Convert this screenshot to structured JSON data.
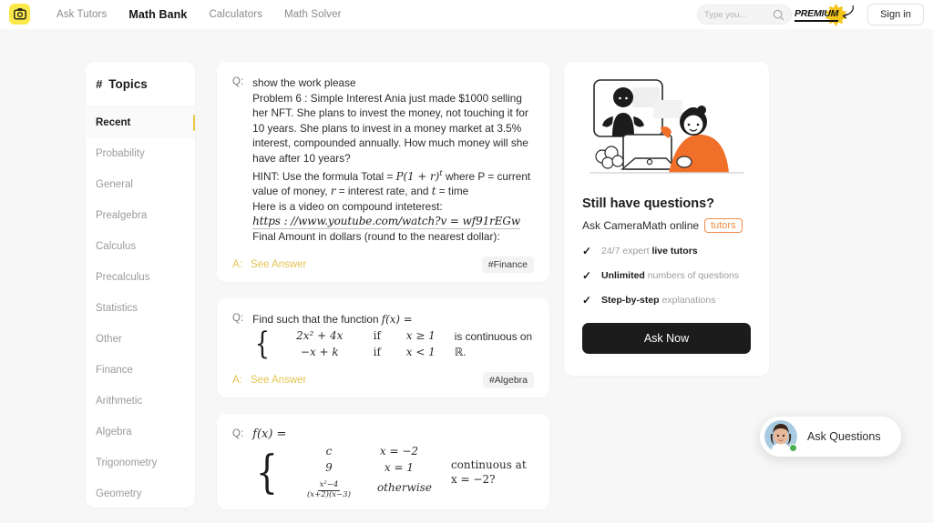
{
  "header": {
    "logo_icon": "camera-icon",
    "nav": [
      {
        "label": "Ask Tutors",
        "active": false
      },
      {
        "label": "Math Bank",
        "active": true
      },
      {
        "label": "Calculators",
        "active": false
      },
      {
        "label": "Math Solver",
        "active": false
      }
    ],
    "search": {
      "placeholder": "Type you...",
      "value": "",
      "icon": "search-icon"
    },
    "premium_label": "PREMIUM",
    "signin_label": "Sign in"
  },
  "sidebar": {
    "title": "Topics",
    "hash": "#",
    "items": [
      {
        "label": "Recent",
        "active": true
      },
      {
        "label": "Probability",
        "active": false
      },
      {
        "label": "General",
        "active": false
      },
      {
        "label": "Prealgebra",
        "active": false
      },
      {
        "label": "Calculus",
        "active": false
      },
      {
        "label": "Precalculus",
        "active": false
      },
      {
        "label": "Statistics",
        "active": false
      },
      {
        "label": "Other",
        "active": false
      },
      {
        "label": "Finance",
        "active": false
      },
      {
        "label": "Arithmetic",
        "active": false
      },
      {
        "label": "Algebra",
        "active": false
      },
      {
        "label": "Trigonometry",
        "active": false
      },
      {
        "label": "Geometry",
        "active": false
      }
    ]
  },
  "cards": {
    "q_label": "Q:",
    "a_label": "A:",
    "see_answer": "See Answer",
    "card1": {
      "line1": "show the work please",
      "line2": "Problem 6 : Simple Interest Ania just made $1000 selling her NFT. She plans to invest the money, not touching it for 10 years. She plans to invest in a money market at 3.5% interest, compounded annually. How much money will she have after 10 years?",
      "hint_prefix": "HINT: Use the formula Total = ",
      "hint_formula": "P(1 + r)",
      "hint_exp": "t",
      "hint_mid": " where P = current value of money, ",
      "hint_r": "r",
      "hint_mid2": " = interest rate, and ",
      "hint_t": "t",
      "hint_end": " = time",
      "video_line": "Here is a video on compound inteterest:",
      "url": "https : //www.youtube.com/watch?v = wf91rEGw",
      "final_line": "Final Amount in dollars (round to the nearest dollar):",
      "tag": "#Finance"
    },
    "card2": {
      "lead": "Find such that the function ",
      "fx": "f(x) =",
      "rows": [
        {
          "expr": "2x² + 4x",
          "if": "if",
          "cond": "x ≥ 1"
        },
        {
          "expr": "−x + k",
          "if": "if",
          "cond": "x < 1"
        }
      ],
      "tail": "is continuous on ℝ.",
      "tag": "#Algebra"
    },
    "card3": {
      "fx": "f(x) =",
      "rows": [
        {
          "expr": "c",
          "cond": "x = −2"
        },
        {
          "expr": "9",
          "cond": "x = 1"
        },
        {
          "expr_num": "x²−4",
          "expr_den": "(x+2)(x−3)",
          "cond": "otherwise"
        }
      ],
      "tail": "continuous at x = −2?"
    }
  },
  "promo": {
    "heading": "Still have questions?",
    "sub_prefix": "Ask CameraMath online",
    "tutors_chip": "tutors",
    "features": [
      {
        "pre": "24/7 expert ",
        "bold": "live tutors",
        "post": ""
      },
      {
        "pre": "",
        "bold": "Unlimited",
        "post": " numbers of questions"
      },
      {
        "pre": "",
        "bold": "Step-by-step",
        "post": " explanations"
      }
    ],
    "cta": "Ask Now",
    "check_icon": "check-icon"
  },
  "float_widget": {
    "label": "Ask Questions",
    "avatar_icon": "avatar",
    "status": "online"
  },
  "colors": {
    "accent_yellow": "#fbe94b",
    "gold": "#e4c452",
    "orange": "#f08c44",
    "dark": "#1c1c1c",
    "page_bg": "#f7f7f7"
  }
}
